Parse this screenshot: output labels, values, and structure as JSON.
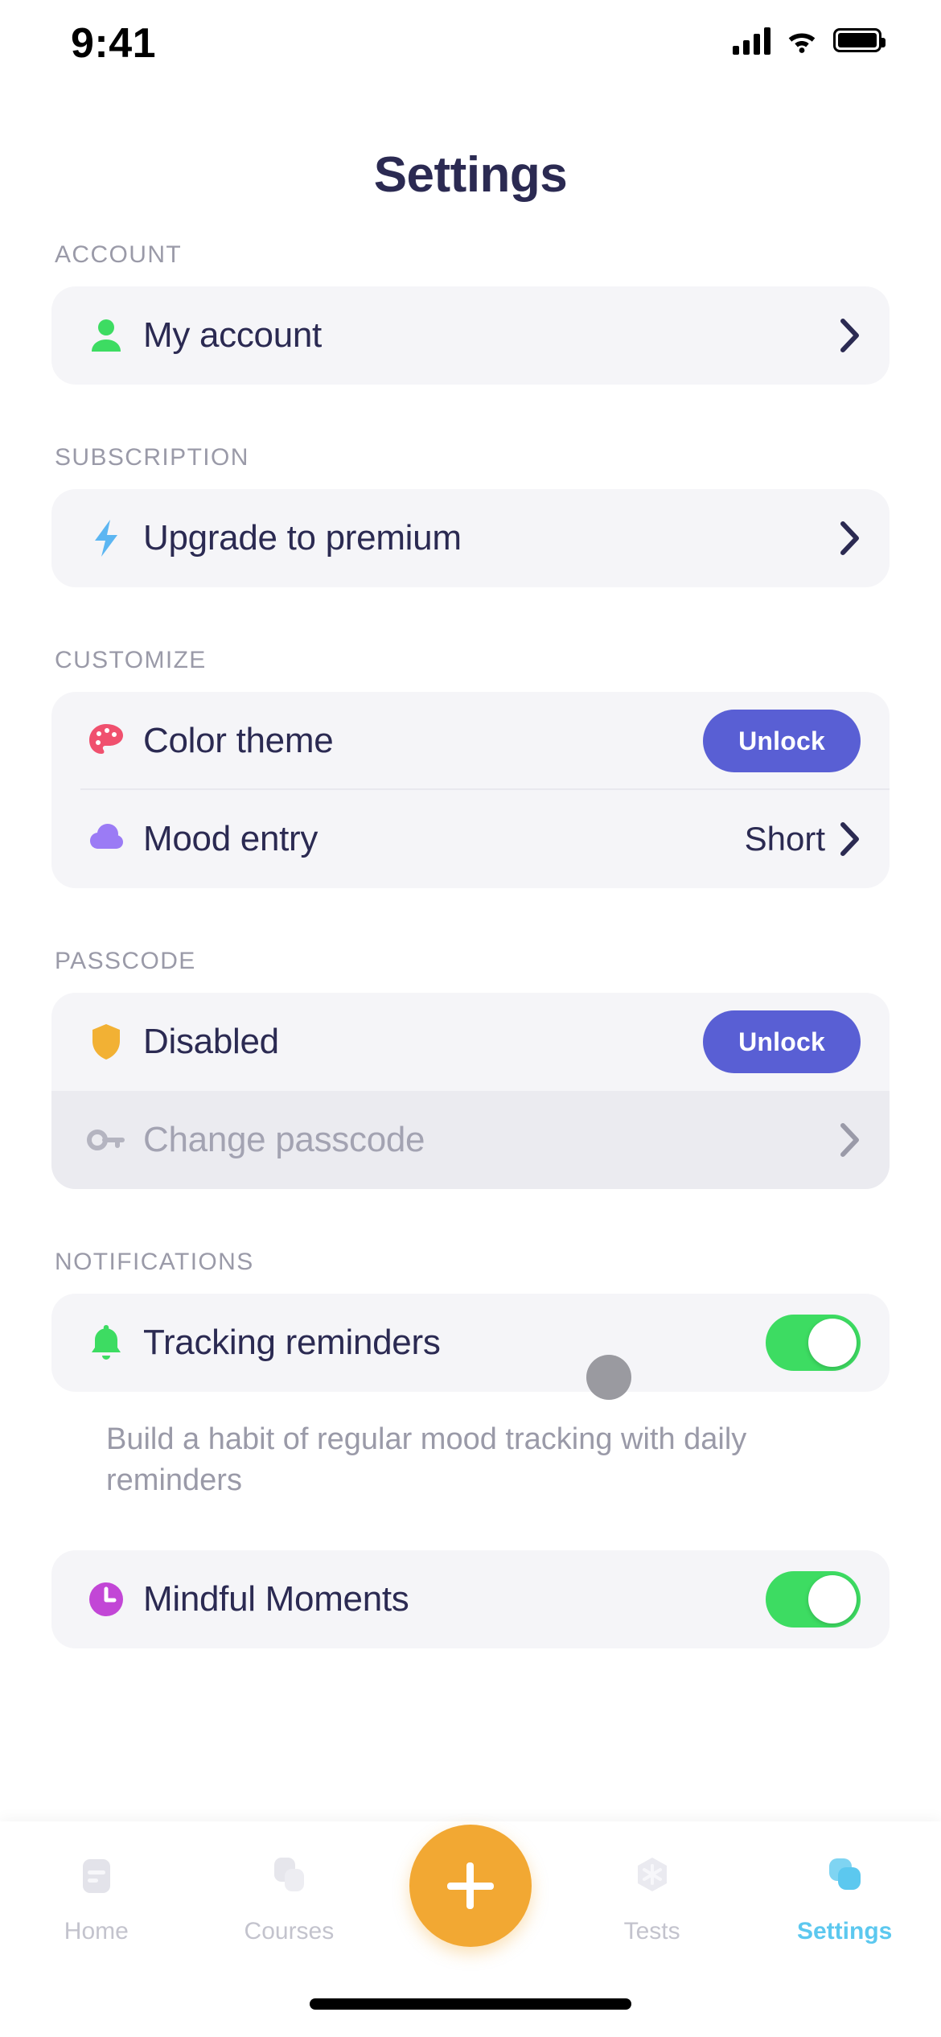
{
  "status_bar": {
    "time": "9:41",
    "cellular_icon": "signal-bars-icon",
    "wifi_icon": "wifi-icon",
    "battery_icon": "battery-full-icon"
  },
  "header": {
    "title": "Settings"
  },
  "sections": [
    {
      "label": "ACCOUNT",
      "rows": [
        {
          "icon": "person-icon",
          "label": "My account",
          "accessory": "chevron-right-icon"
        }
      ]
    },
    {
      "label": "SUBSCRIPTION",
      "rows": [
        {
          "icon": "lightning-bolt-icon",
          "label": "Upgrade to premium",
          "accessory": "chevron-right-icon"
        }
      ]
    },
    {
      "label": "CUSTOMIZE",
      "rows": [
        {
          "icon": "palette-icon",
          "label": "Color theme",
          "accessory": "unlock-button",
          "button_label": "Unlock"
        },
        {
          "icon": "cloud-icon",
          "label": "Mood entry",
          "value": "Short",
          "accessory": "chevron-right-icon"
        }
      ]
    },
    {
      "label": "PASSCODE",
      "rows": [
        {
          "icon": "shield-icon",
          "label": "Disabled",
          "accessory": "unlock-button",
          "button_label": "Unlock"
        },
        {
          "icon": "key-icon",
          "label": "Change passcode",
          "accessory": "chevron-right-icon",
          "disabled": true
        }
      ]
    },
    {
      "label": "NOTIFICATIONS",
      "rows": [
        {
          "icon": "bell-icon",
          "label": "Tracking reminders",
          "accessory": "toggle",
          "toggle_on": true
        }
      ],
      "helper_text": "Build a habit of regular mood tracking with daily reminders"
    },
    {
      "label": "",
      "rows": [
        {
          "icon": "clock-icon",
          "label": "Mindful Moments",
          "accessory": "toggle",
          "toggle_on": true
        }
      ]
    }
  ],
  "labels": {
    "account": "ACCOUNT",
    "subscription": "SUBSCRIPTION",
    "customize": "CUSTOMIZE",
    "passcode": "PASSCODE",
    "notifications": "NOTIFICATIONS"
  },
  "rows": {
    "my_account": "My account",
    "upgrade": "Upgrade to premium",
    "color_theme": "Color theme",
    "color_theme_button": "Unlock",
    "mood_entry": "Mood entry",
    "mood_entry_value": "Short",
    "passcode_status": "Disabled",
    "passcode_button": "Unlock",
    "change_passcode": "Change passcode",
    "tracking_reminders": "Tracking reminders",
    "tracking_helper": "Build a habit of regular mood tracking with daily reminders",
    "mindful_moments": "Mindful Moments"
  },
  "tabbar": {
    "items": [
      {
        "label": "Home",
        "icon": "home-icon",
        "active": false
      },
      {
        "label": "Courses",
        "icon": "courses-icon",
        "active": false
      },
      {
        "label": "",
        "icon": "plus-icon",
        "active": false
      },
      {
        "label": "Tests",
        "icon": "tests-icon",
        "active": false
      },
      {
        "label": "Settings",
        "icon": "settings-icon",
        "active": true
      }
    ]
  },
  "colors": {
    "title": "#2b2a52",
    "section_label": "#9a9aa8",
    "card_bg": "#f5f5f8",
    "unlock_button": "#595fd4",
    "toggle_on": "#3ddc62",
    "fab": "#f2a833",
    "active_tab": "#5cc8ef",
    "person_icon": "#3ddc62",
    "bolt_icon": "#5cb6f2",
    "palette_icon": "#f0506e",
    "cloud_icon": "#9b7bf5",
    "shield_icon": "#f2b134",
    "key_icon": "#b4b4c0",
    "bell_icon": "#3ddc62",
    "clock_icon": "#c246d6",
    "cursor_dot": "#9a9aa0"
  }
}
